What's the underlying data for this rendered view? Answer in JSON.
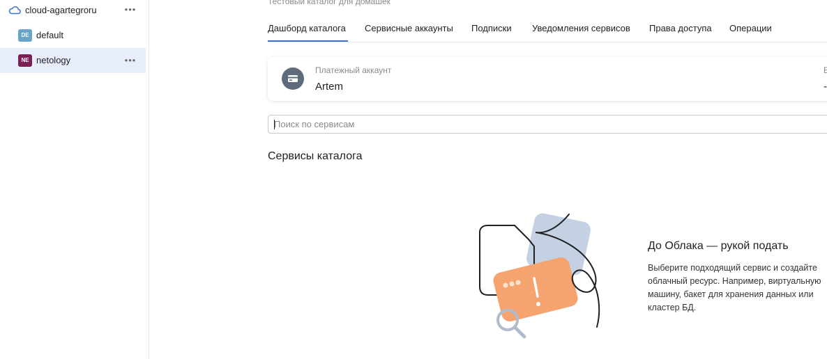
{
  "sidebar": {
    "cloud": {
      "name": "cloud-agartegroru",
      "icon": "cloud-icon"
    },
    "folders": [
      {
        "badge": "DE",
        "label": "default",
        "badge_color": "#6aa3c8",
        "selected": false
      },
      {
        "badge": "NE",
        "label": "netology",
        "badge_color": "#7c1f55",
        "selected": true
      }
    ],
    "more_glyph": "•••"
  },
  "header": {
    "subtitle": "Тестовый каталог для домашек",
    "tabs": [
      {
        "label": "Дашборд каталога",
        "active": true
      },
      {
        "label": "Сервисные аккаунты",
        "active": false
      },
      {
        "label": "Подписки",
        "active": false
      },
      {
        "label": "Уведомления сервисов",
        "active": false
      },
      {
        "label": "Права доступа",
        "active": false
      },
      {
        "label": "Операции",
        "active": false
      }
    ],
    "accent": "#3b6fd4"
  },
  "billing": {
    "label": "Платежный аккаунт",
    "value": "Artem",
    "extra_label": "Б",
    "extra_value": "-",
    "icon": "credit-card-icon"
  },
  "search": {
    "placeholder": "Поиск по сервисам",
    "value": ""
  },
  "services": {
    "title": "Сервисы каталога",
    "empty_title": "До Облака — рукой подать",
    "empty_text": "Выберите подходящий сервис и создайте облачный ресурс. Например, виртуальную машину, бакет для хранения данных или кластер БД."
  }
}
